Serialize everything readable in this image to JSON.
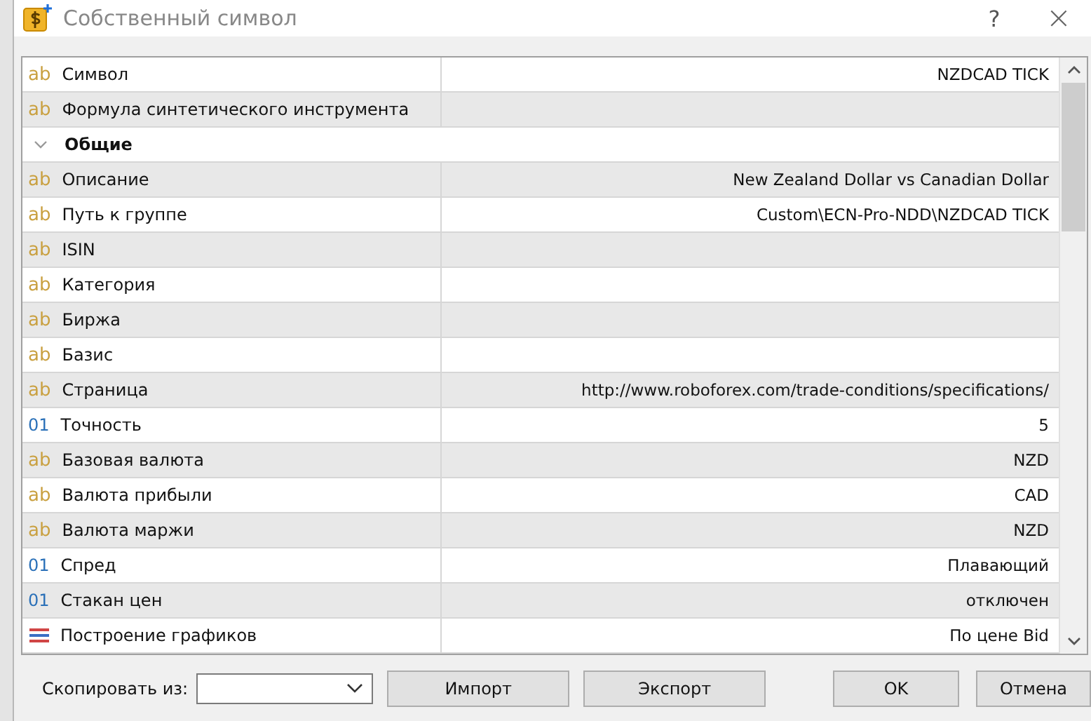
{
  "window": {
    "title": "Собственный символ",
    "help": "?",
    "close": "×"
  },
  "properties": [
    {
      "kind": "text",
      "icon": "ab",
      "label": "Символ",
      "value": "NZDCAD TICK"
    },
    {
      "kind": "text",
      "icon": "ab",
      "label": "Формула синтетического инструмента"
    },
    {
      "kind": "group",
      "label": "Общие",
      "expanded": true
    },
    {
      "kind": "text",
      "icon": "ab",
      "label": "Описание",
      "value": "New Zealand Dollar vs Canadian Dollar"
    },
    {
      "kind": "text",
      "icon": "ab",
      "label": "Путь к группе",
      "value": "Custom\\ECN-Pro-NDD\\NZDCAD TICK"
    },
    {
      "kind": "text",
      "icon": "ab",
      "label": "ISIN"
    },
    {
      "kind": "text",
      "icon": "ab",
      "label": "Категория"
    },
    {
      "kind": "text",
      "icon": "ab",
      "label": "Биржа"
    },
    {
      "kind": "text",
      "icon": "ab",
      "label": "Базис"
    },
    {
      "kind": "text",
      "icon": "ab",
      "label": "Страница",
      "value": "http://www.roboforex.com/trade-conditions/specifications/"
    },
    {
      "kind": "number",
      "icon": "01",
      "label": "Точность",
      "value": "5"
    },
    {
      "kind": "text",
      "icon": "ab",
      "label": "Базовая валюта",
      "value": "NZD"
    },
    {
      "kind": "text",
      "icon": "ab",
      "label": "Валюта прибыли",
      "value": "CAD"
    },
    {
      "kind": "text",
      "icon": "ab",
      "label": "Валюта маржи",
      "value": "NZD"
    },
    {
      "kind": "number",
      "icon": "01",
      "label": "Спред",
      "value": "Плавающий"
    },
    {
      "kind": "number",
      "icon": "01",
      "label": "Стакан цен",
      "value": "отключен"
    },
    {
      "kind": "enum",
      "label": "Построение графиков",
      "value": "По цене Bid"
    }
  ],
  "footer": {
    "copy_label": "Скопировать из:",
    "buttons": [
      "Импорт",
      "Экспорт"
    ],
    "ok": "OK",
    "cancel": "Отмена"
  }
}
